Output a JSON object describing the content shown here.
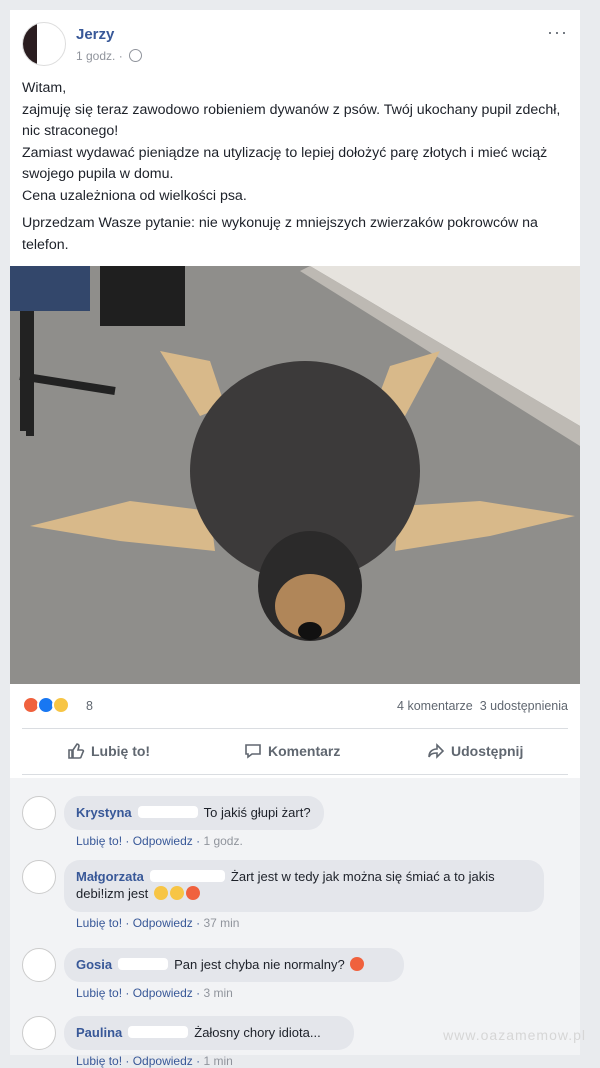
{
  "post": {
    "author": "Jerzy",
    "time": "1 godz.",
    "more": "···",
    "text": [
      "Witam,",
      "zajmuję się teraz zawodowo robieniem dywanów z psów. Twój ukochany pupil zdechł, nic straconego!",
      "Zamiast wydawać pieniądze na utylizację to lepiej dołożyć parę złotych i mieć wciąż swojego pupila w domu.",
      "Cena uzależniona od wielkości psa.",
      "Uprzedzam Wasze pytanie: nie wykonuję z mniejszych zwierzaków pokrowców na telefon."
    ]
  },
  "reactions": {
    "count": "8",
    "comments": "4 komentarze",
    "shares": "3 udostępnienia"
  },
  "actions": {
    "like": "Lubię to!",
    "comment": "Komentarz",
    "share": "Udostępnij"
  },
  "comments": [
    {
      "name": "Krystyna",
      "text": "To jakiś głupi żart?",
      "like": "Lubię to!",
      "reply": "Odpowiedz",
      "time": "1 godz."
    },
    {
      "name": "Małgorzata",
      "text": "Żart jest w tedy jak można się śmiać a to jakis debi!izm jest",
      "like": "Lubię to!",
      "reply": "Odpowiedz",
      "time": "37 min"
    },
    {
      "name": "Gosia",
      "text": "Pan jest chyba nie normalny?",
      "like": "Lubię to!",
      "reply": "Odpowiedz",
      "time": "3 min"
    },
    {
      "name": "Paulina",
      "text": "Żałosny chory idiota...",
      "like": "Lubię to!",
      "reply": "Odpowiedz",
      "time": "1 min"
    }
  ],
  "watermark": "www.oazamemow.pl"
}
